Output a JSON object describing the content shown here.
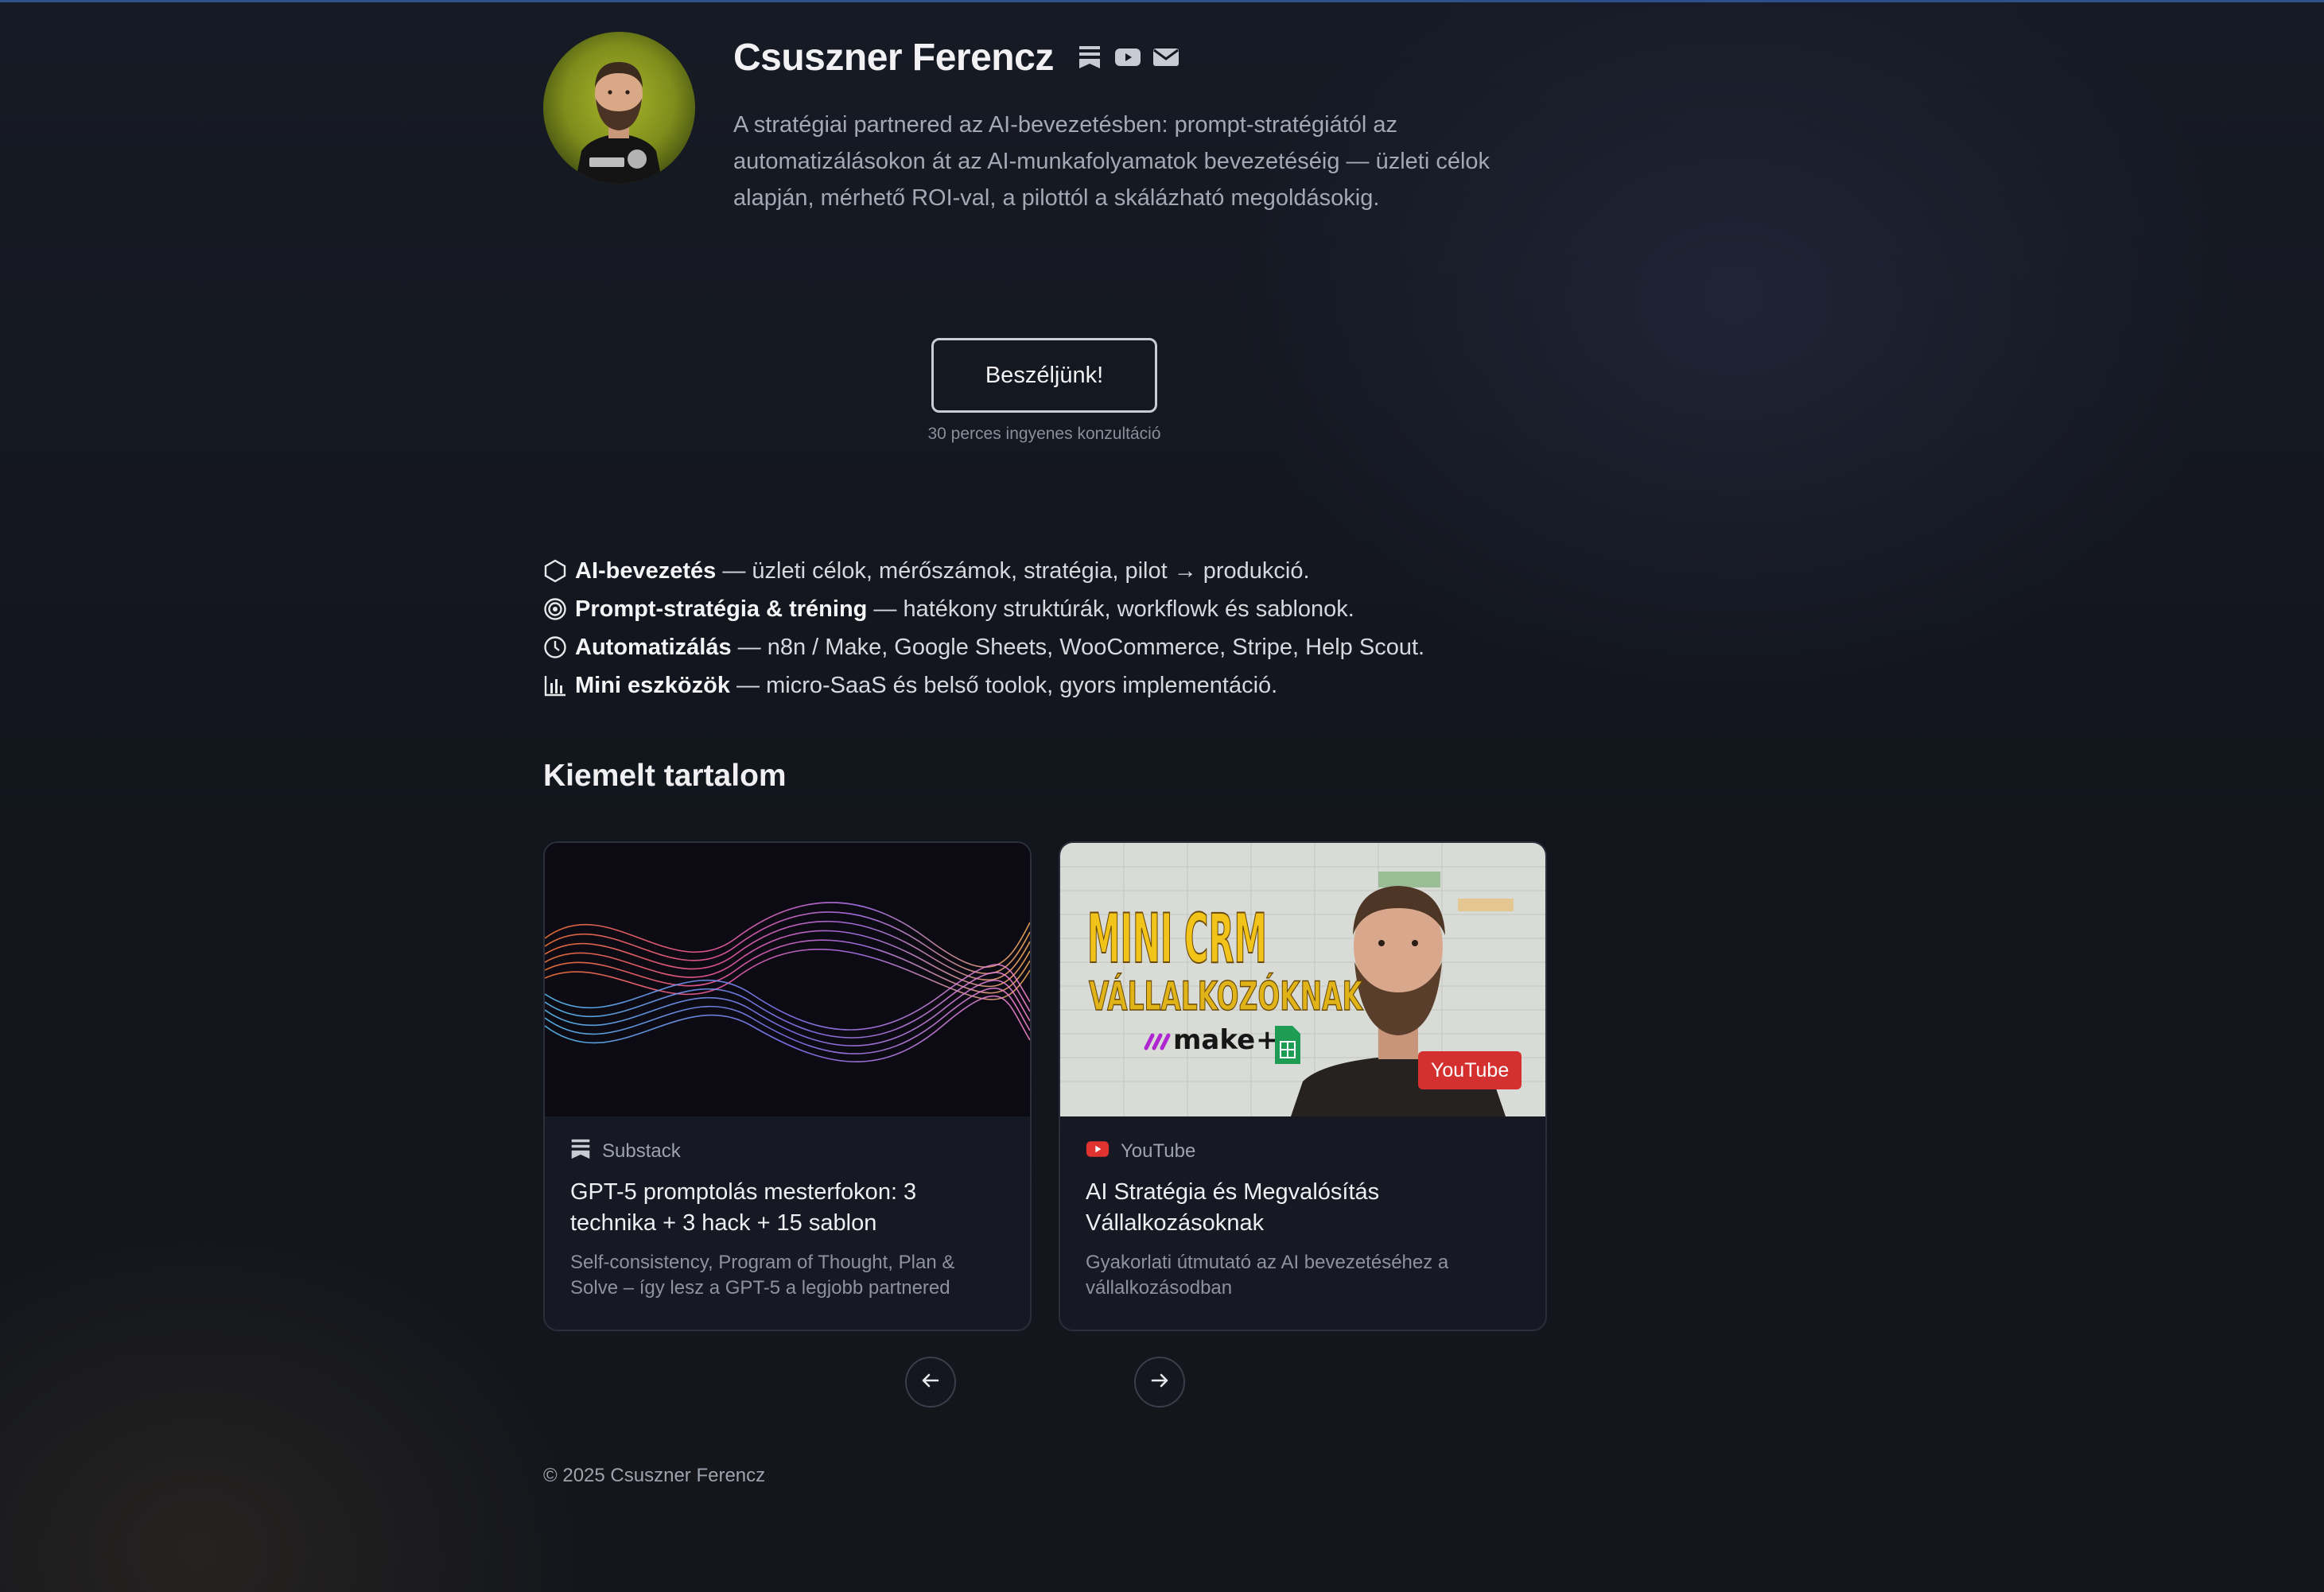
{
  "colors": {
    "background": "#14161c",
    "accent_line": "#2f4f8a",
    "text_primary": "#f2f2f5",
    "text_muted": "#a4a8b4",
    "youtube_red": "#d53030"
  },
  "header": {
    "name": "Csuszner Ferencz",
    "social_icons": [
      "substack-icon",
      "youtube-icon",
      "mail-icon"
    ],
    "tagline": "A stratégiai partnered az AI-bevezetésben: prompt-stratégiától az automatizálásokon át az AI-munkafolyamatok bevezetéséig — üzleti célok alapján, mérhető ROI-val, a pilottól a skálázható megoldásokig."
  },
  "cta": {
    "label": "Beszéljünk!",
    "subtext": "30 perces ingyenes konzultáció"
  },
  "features": [
    {
      "icon": "hexagon-icon",
      "title": "AI-bevezetés",
      "text": " — üzleti célok, mérőszámok, stratégia, pilot → produkció."
    },
    {
      "icon": "target-icon",
      "title": "Prompt-stratégia & tréning",
      "text": " — hatékony struktúrák, workflowk és sablonok."
    },
    {
      "icon": "clock-icon",
      "title": "Automatizálás",
      "text": " — n8n / Make, Google Sheets, WooCommerce, Stripe, Help Scout."
    },
    {
      "icon": "bar-chart-icon",
      "title": "Mini eszközök",
      "text": " — micro-SaaS és belső toolok, gyors implementáció."
    }
  ],
  "featured": {
    "title": "Kiemelt tartalom",
    "cards": [
      {
        "source": "Substack",
        "source_icon": "substack-icon",
        "title": "GPT-5 promptolás mesterfokon: 3 technika + 3 hack + 15 sablon",
        "description": "Self-consistency, Program of Thought, Plan & Solve – így lesz a GPT-5 a legjobb partnered"
      },
      {
        "source": "YouTube",
        "source_icon": "youtube-icon",
        "title": "AI Stratégia és Megvalósítás Vállalkozásoknak",
        "description": "Gyakorlati útmutató az AI bevezetéséhez a vállalkozásodban",
        "badge": "YouTube",
        "thumb_text": {
          "line1": "MINI CRM",
          "line2": "VÁLLALKOZÓKNAK",
          "brand": "make",
          "plus": "+"
        }
      }
    ],
    "nav": {
      "prev_icon": "arrow-left-icon",
      "next_icon": "arrow-right-icon"
    }
  },
  "footer": {
    "copyright": "© 2025 Csuszner Ferencz"
  }
}
